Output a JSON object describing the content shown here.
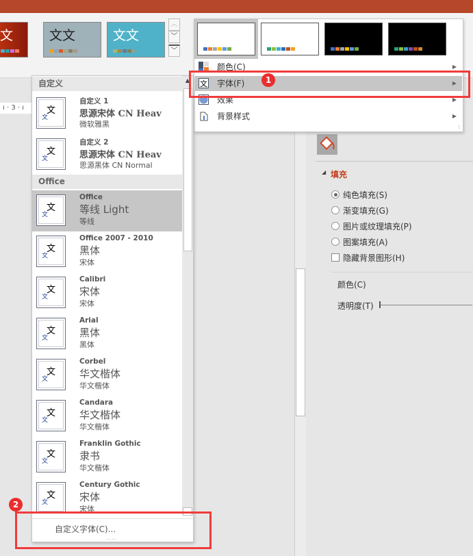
{
  "ribbon": {
    "themes": [
      {
        "text": "文",
        "bg": "#c0391b",
        "text_color": "#fff",
        "swatches": [
          "#58a8c6",
          "#2aa199",
          "#c76fe3",
          "#f08060"
        ]
      },
      {
        "text": "文文",
        "bg": "#9fb1b9",
        "text_color": "#222",
        "swatches": [
          "#f0a020",
          "#8fa3b0",
          "#d85a2a",
          "#a3a58a",
          "#8a7f62",
          "#a89a88"
        ]
      },
      {
        "text": "文文",
        "bg": "#4fb2c8",
        "text_color": "#fff",
        "swatches": [
          "#a8b27a",
          "#998d58",
          "#6e7a8a",
          "#7d8562",
          "#8aa091"
        ]
      }
    ]
  },
  "ruler": {
    "mark": "3"
  },
  "variants": {
    "thumbnails": [
      {
        "bg": "#ffffff",
        "selected": true,
        "swatches": [
          "#4472c4",
          "#ed7d31",
          "#a5a5a5",
          "#ffc000",
          "#5b9bd5",
          "#70ad47"
        ]
      },
      {
        "bg": "#ffffff",
        "selected": false,
        "swatches": [
          "#2aa27a",
          "#8fbe3f",
          "#3ab0d0",
          "#2a6eb0",
          "#c5501e",
          "#f0a020"
        ]
      },
      {
        "bg": "#000000",
        "selected": false,
        "swatches": [
          "#4472c4",
          "#ed7d31",
          "#a5a5a5",
          "#ffc000",
          "#5b9bd5",
          "#70ad47"
        ]
      },
      {
        "bg": "#000000",
        "selected": false,
        "swatches": [
          "#2aa27a",
          "#8fbe3f",
          "#3aa0c8",
          "#7a4fb0",
          "#c5501e",
          "#d08a30"
        ]
      }
    ],
    "menu": [
      {
        "label": "颜色(C)",
        "icon": "color-palette-icon"
      },
      {
        "label": "字体(F)",
        "icon": "font-icon",
        "highlighted": true
      },
      {
        "label": "效果",
        "icon": "effects-icon"
      },
      {
        "label": "背景样式",
        "icon": "background-style-icon"
      }
    ]
  },
  "fonts": {
    "sections": [
      "自定义",
      "Office"
    ],
    "items": [
      {
        "name": "自定义 1",
        "heading": "思源宋体 CN Heav",
        "body": "微软雅黑"
      },
      {
        "name": "自定义 2",
        "heading": "思源宋体 CN Heav",
        "body": "思源黑体 CN Normal"
      },
      {
        "name": "Office",
        "heading": "等线 Light",
        "body": "等线",
        "selected": true
      },
      {
        "name": "Office 2007 - 2010",
        "heading": "黑体",
        "body": "宋体"
      },
      {
        "name": "Calibri",
        "heading": "宋体",
        "body": "宋体"
      },
      {
        "name": "Arial",
        "heading": "黑体",
        "body": "黑体"
      },
      {
        "name": "Corbel",
        "heading": "华文楷体",
        "body": "华文楷体"
      },
      {
        "name": "Candara",
        "heading": "华文楷体",
        "body": "华文楷体"
      },
      {
        "name": "Franklin Gothic",
        "heading": "隶书",
        "body": "华文楷体"
      },
      {
        "name": "Century Gothic",
        "heading": "宋体",
        "body": "宋体"
      }
    ],
    "preview_text": "文",
    "preview_small": "文",
    "custom_fonts_label": "自定义字体(C)...",
    "grip": "....",
    "scroll_up": "▲"
  },
  "pane": {
    "section": "填充",
    "section_color": "#c43e1c",
    "options": [
      {
        "label": "纯色填充(S)",
        "checked": true
      },
      {
        "label": "渐变填充(G)",
        "checked": false
      },
      {
        "label": "图片或纹理填充(P)",
        "checked": false
      },
      {
        "label": "图案填充(A)",
        "checked": false
      }
    ],
    "hide_bg_label": "隐藏背景图形(H)",
    "color_label": "颜色(C)",
    "transparency_label": "透明度(T)"
  },
  "annotations": {
    "badge1": "1",
    "badge2": "2",
    "color": "#f03b3b"
  }
}
